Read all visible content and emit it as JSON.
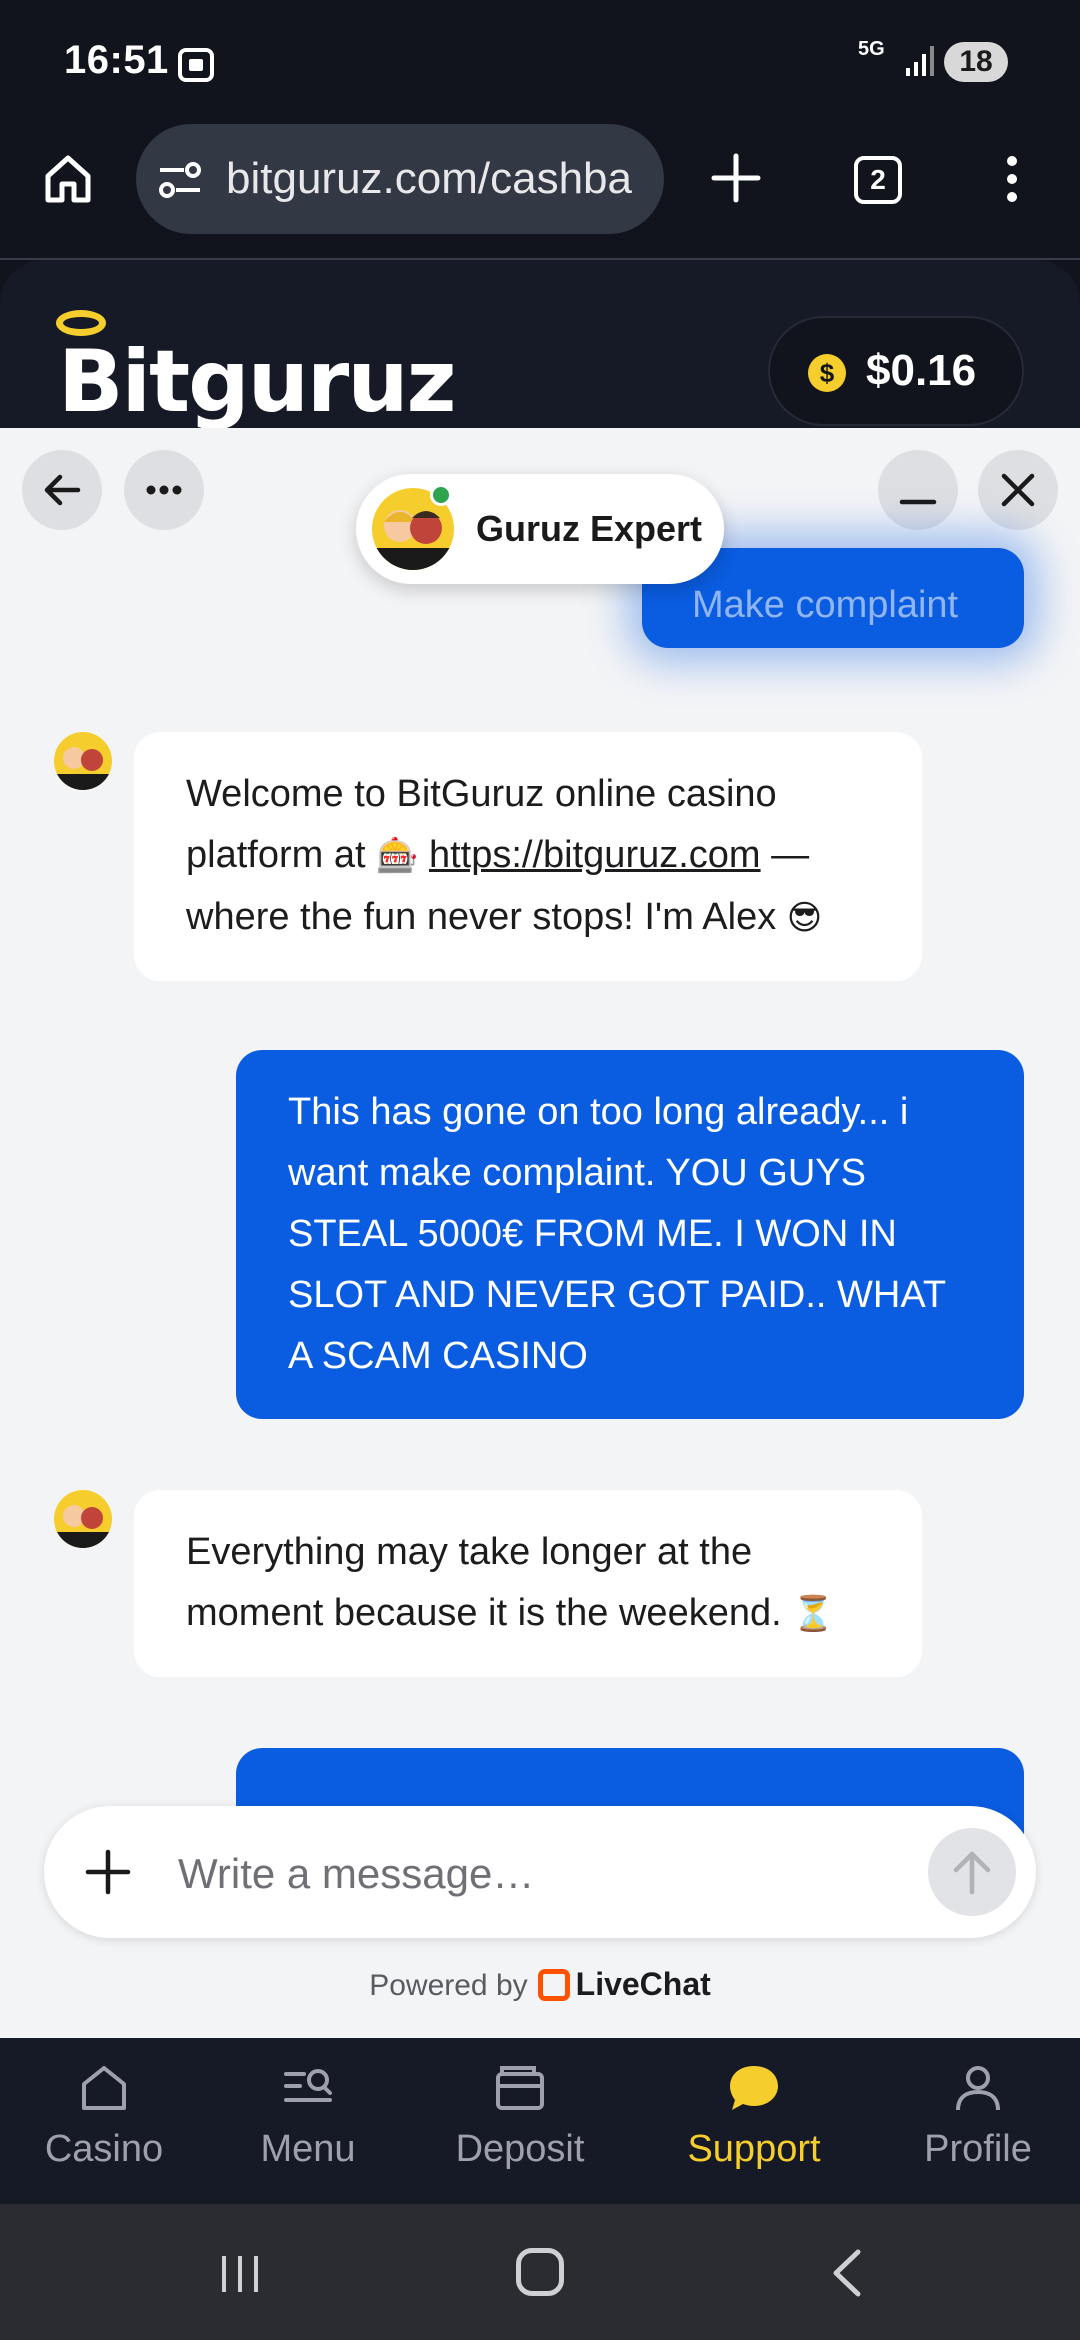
{
  "status_bar": {
    "time": "16:51",
    "network": "5G",
    "battery": "18"
  },
  "browser": {
    "url": "bitguruz.com/cashba",
    "tab_count": "2"
  },
  "site": {
    "logo_text": "Bitguruz",
    "balance": "$0.16",
    "coin_symbol": "$"
  },
  "chat": {
    "agent_name": "Guruz Expert",
    "partial_top_message": "Make complaint",
    "messages": [
      {
        "from": "agent",
        "text_before_link": "Welcome to BitGuruz online casino platform at ",
        "emoji_1": "🎰",
        "link": "https://bitguruz.com",
        "text_after_link": " — where the fun never stops! I'm Alex ",
        "emoji_2": "😎"
      },
      {
        "from": "user",
        "text": "This has gone on too long already... i want make complaint. YOU GUYS STEAL 5000€ FROM ME. I WON IN SLOT AND NEVER GOT PAID.. WHAT A SCAM CASINO"
      },
      {
        "from": "agent",
        "text": "Everything may take longer at the moment because it is the weekend. ",
        "emoji": "⏳"
      }
    ],
    "composer_placeholder": "Write a message…",
    "powered_by_label": "Powered by",
    "powered_by_brand": "LiveChat"
  },
  "bottom_nav": {
    "items": [
      {
        "label": "Casino",
        "icon": "home-icon"
      },
      {
        "label": "Menu",
        "icon": "menu-search-icon"
      },
      {
        "label": "Deposit",
        "icon": "wallet-icon"
      },
      {
        "label": "Support",
        "icon": "chat-bubble-icon"
      },
      {
        "label": "Profile",
        "icon": "user-icon"
      }
    ],
    "active": "Support",
    "active_color": "#f5cd2c"
  },
  "colors": {
    "brand_blue": "#0a5ce0",
    "dark_bg": "#11141c",
    "accent_yellow": "#f5cd2c"
  }
}
